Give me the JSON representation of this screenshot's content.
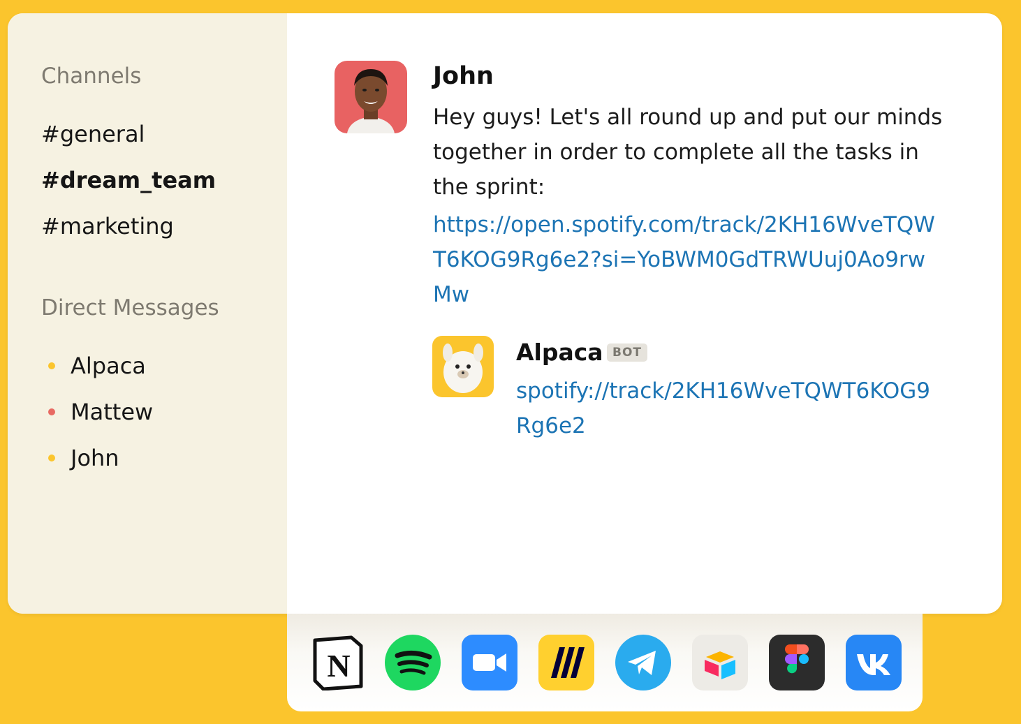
{
  "sidebar": {
    "channels_title": "Channels",
    "channels": [
      {
        "label": "#general",
        "active": false
      },
      {
        "label": "#dream_team",
        "active": true
      },
      {
        "label": "#marketing",
        "active": false
      }
    ],
    "dm_title": "Direct Messages",
    "dms": [
      {
        "label": "Alpaca",
        "status_color": "#FBC52D"
      },
      {
        "label": "Mattew",
        "status_color": "#E86A62"
      },
      {
        "label": "John",
        "status_color": "#FBC52D"
      }
    ]
  },
  "messages": [
    {
      "author": "John",
      "text": "Hey guys! Let's all round up and put our minds together in order to complete all the tasks in the sprint:",
      "link": "https://open.spotify.com/track/2KH16WveTQWT6KOG9Rg6e2?si=YoBWM0GdTRWUuj0Ao9rwMw"
    },
    {
      "author": "Alpaca",
      "badge": "BOT",
      "link": "spotify://track/2KH16WveTQWT6KOG9Rg6e2"
    }
  ],
  "dock": {
    "apps": [
      "notion-icon",
      "spotify-icon",
      "zoom-icon",
      "miro-icon",
      "telegram-icon",
      "airtable-icon",
      "figma-icon",
      "vk-icon"
    ]
  },
  "colors": {
    "background": "#FBC52D",
    "sidebar": "#F6F2E2",
    "link": "#1C74B4"
  }
}
